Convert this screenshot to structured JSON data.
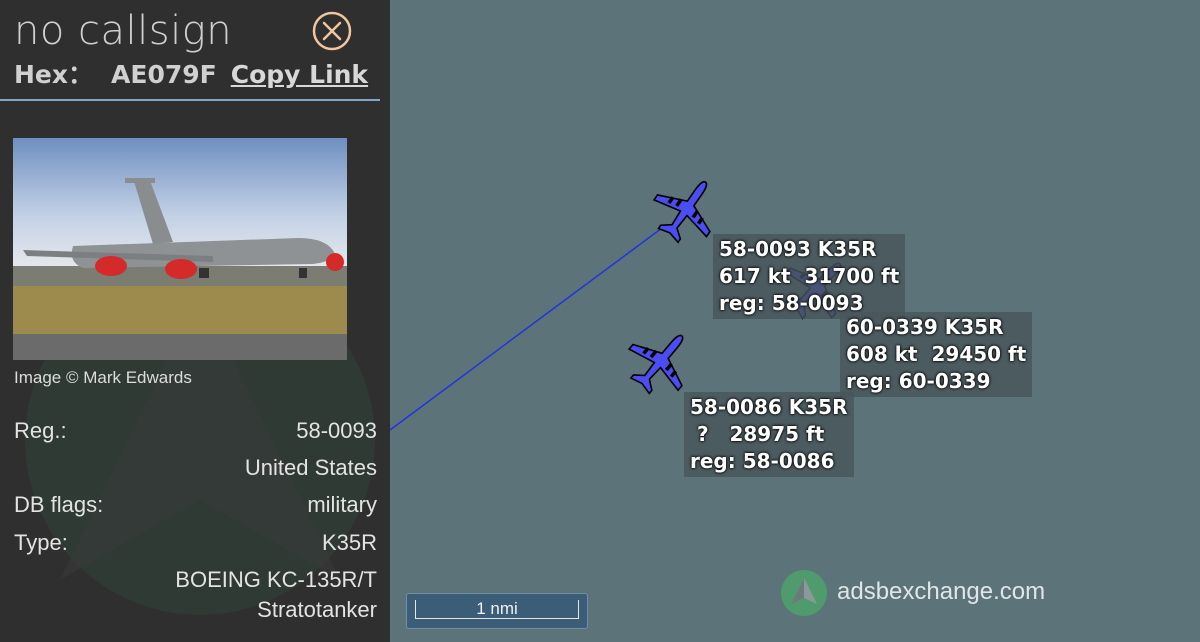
{
  "panel": {
    "callsign": "no callsign",
    "hex_label": "Hex：",
    "hex_value": "AE079F",
    "copy_link_label": "Copy Link",
    "image_credit": "Image © Mark Edwards",
    "details": [
      {
        "label": "Reg.:",
        "value": "58-0093"
      },
      {
        "label": "",
        "value": "United States"
      },
      {
        "label": "DB flags:",
        "value": "military"
      },
      {
        "label": "Type:",
        "value": "K35R"
      },
      {
        "label": "",
        "value": "BOEING KC-135R/T"
      },
      {
        "label": "",
        "value": "Stratotanker"
      }
    ]
  },
  "aircraft": [
    {
      "line1": "58-0093 K35R",
      "line2": "617 kt  31700 ft",
      "line3": "reg: 58-0093",
      "selected": true
    },
    {
      "line1": "60-0339 K35R",
      "line2": "608 kt  29450 ft",
      "line3": "reg: 60-0339",
      "selected": false
    },
    {
      "line1": "58-0086 K35R",
      "line2": " ?   28975 ft",
      "line3": "reg: 58-0086",
      "selected": false
    }
  ],
  "scale_label": "1 nmi",
  "brand_name": "adsbexchange.com",
  "colors": {
    "map_bg": "#5d737a",
    "panel_bg": "#2f2f2f",
    "plane_fill": "#4a4df0",
    "track_line": "#2233dd",
    "close_accent": "#f2c59c"
  },
  "icons": [
    "close-icon",
    "aircraft-icon",
    "adsbexchange-logo"
  ]
}
